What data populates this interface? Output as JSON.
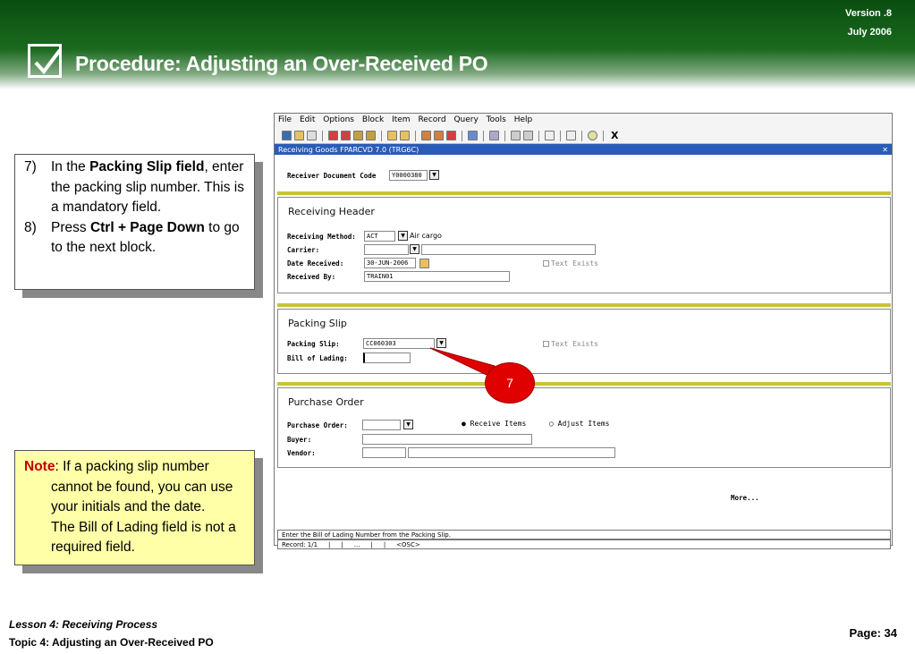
{
  "header": {
    "version": "Version .8",
    "date": "July  2006",
    "title": "Procedure:  Adjusting an Over-Received PO"
  },
  "steps": [
    {
      "num": "7)",
      "pre": "In the ",
      "bold": "Packing Slip field",
      "post": ", enter the packing slip number.  This is a mandatory field."
    },
    {
      "num": "8)",
      "pre": "Press ",
      "bold": "Ctrl + Page Down",
      "post": " to go to the next block."
    }
  ],
  "note": {
    "label": "Note",
    "text1": ": If a packing slip number cannot be found, you can use your initials and the date.",
    "text2": "The Bill of Lading field is not a required field."
  },
  "app": {
    "menu": [
      "File",
      "Edit",
      "Options",
      "Block",
      "Item",
      "Record",
      "Query",
      "Tools",
      "Help"
    ],
    "window_title": "Receiving Goods  FPARCVD  7.0  (TRG6C)",
    "receiver_doc_label": "Receiver Document Code",
    "receiver_doc_value": "Y0000380",
    "header_title": "Receiving Header",
    "receiving_method_label": "Receiving Method:",
    "receiving_method_value": "ACT",
    "receiving_method_desc": "Air cargo",
    "carrier_label": "Carrier:",
    "date_label": "Date Received:",
    "date_value": "30-JUN-2006",
    "received_by_label": "Received By:",
    "received_by_value": "TRAIN01",
    "text_exists": "Text Exists",
    "packing_title": "Packing Slip",
    "packing_label": "Packing Slip:",
    "packing_value": "CC060303",
    "bill_label": "Bill of Lading:",
    "po_title": "Purchase Order",
    "po_label": "Purchase Order:",
    "receive_items": "Receive Items",
    "adjust_items": "Adjust Items",
    "buyer_label": "Buyer:",
    "vendor_label": "Vendor:",
    "more": "More...",
    "status_msg": "Enter the Bill of Lading Number from the Packing Slip.",
    "record": "Record: 1/1",
    "dots": "...",
    "osc": "<OSC>"
  },
  "callout": "7",
  "footer": {
    "lesson": "Lesson 4: Receiving Process",
    "topic": "Topic 4: Adjusting an Over-Received PO",
    "page": "Page: 34"
  }
}
